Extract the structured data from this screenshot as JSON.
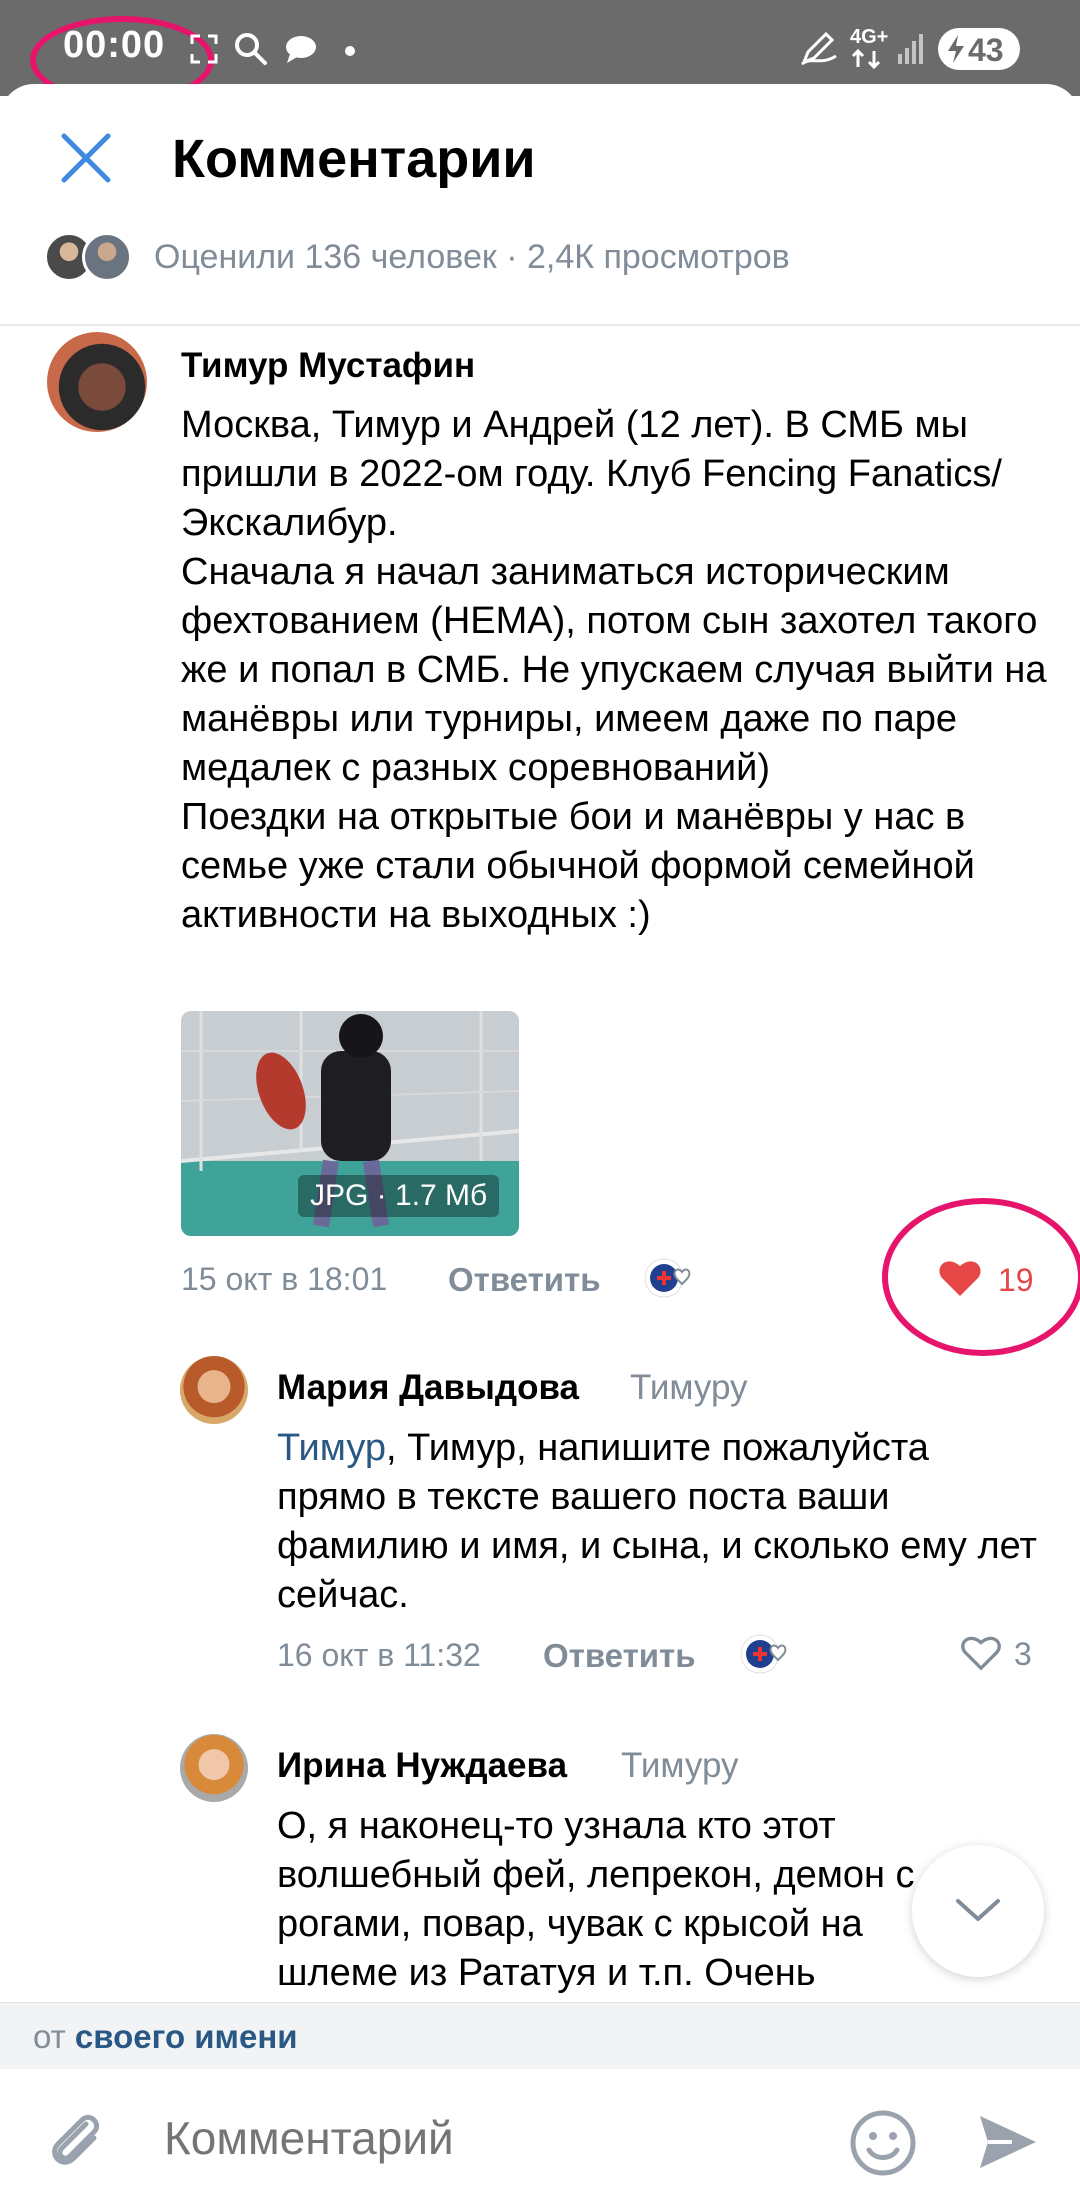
{
  "status_bar": {
    "time": "00:00",
    "network": "4G+",
    "battery": "43"
  },
  "header": {
    "title": "Комментарии",
    "likes_summary": "Оценили 136 человек · 2,4К просмотров"
  },
  "comments": [
    {
      "author": "Тимур Мустафин",
      "text": "Москва, Тимур и Андрей (12 лет). В СМБ мы пришли в 2022-ом году. Клуб Fencing Fanatics/Экскалибур.\nСначала я начал заниматься историческим фехтованием (HEMA), потом сын захотел такого же и попал в СМБ. Не упускаем случая выйти на манёвры или турниры, имеем даже по паре медалек с разных соревнований)\nПоездки на открытые бои и манёвры у нас в семье уже стали обычной формой семейной активности на выходных :)",
      "attachment_label": "JPG · 1.7 Мб",
      "date": "15 окт в 18:01",
      "reply_label": "Ответить",
      "likes": "19",
      "liked": true
    },
    {
      "author": "Мария Давыдова",
      "reply_to": "Тимуру",
      "mention": "Тимур",
      "text": ", Тимур, напишите пожалуйста прямо в тексте вашего поста ваши фамилию и имя, и сына, и сколько ему лет сейчас.",
      "date": "16 окт в 11:32",
      "reply_label": "Ответить",
      "likes": "3",
      "liked": false
    },
    {
      "author": "Ирина Нуждаева",
      "reply_to": "Тимуру",
      "text": "О, я наконец-то узнала кто этот волшебный фей, лепрекон, демон с рогами, повар, чувак с крысой на шлеме из Рататуя и т.п. Очень"
    }
  ],
  "composer": {
    "from_prefix": "от",
    "from_name": "своего имени",
    "placeholder": "Комментарий"
  },
  "colors": {
    "accent": "#2a5885",
    "like_red": "#e64646",
    "annotation": "#e6156b",
    "muted": "#818c99"
  }
}
